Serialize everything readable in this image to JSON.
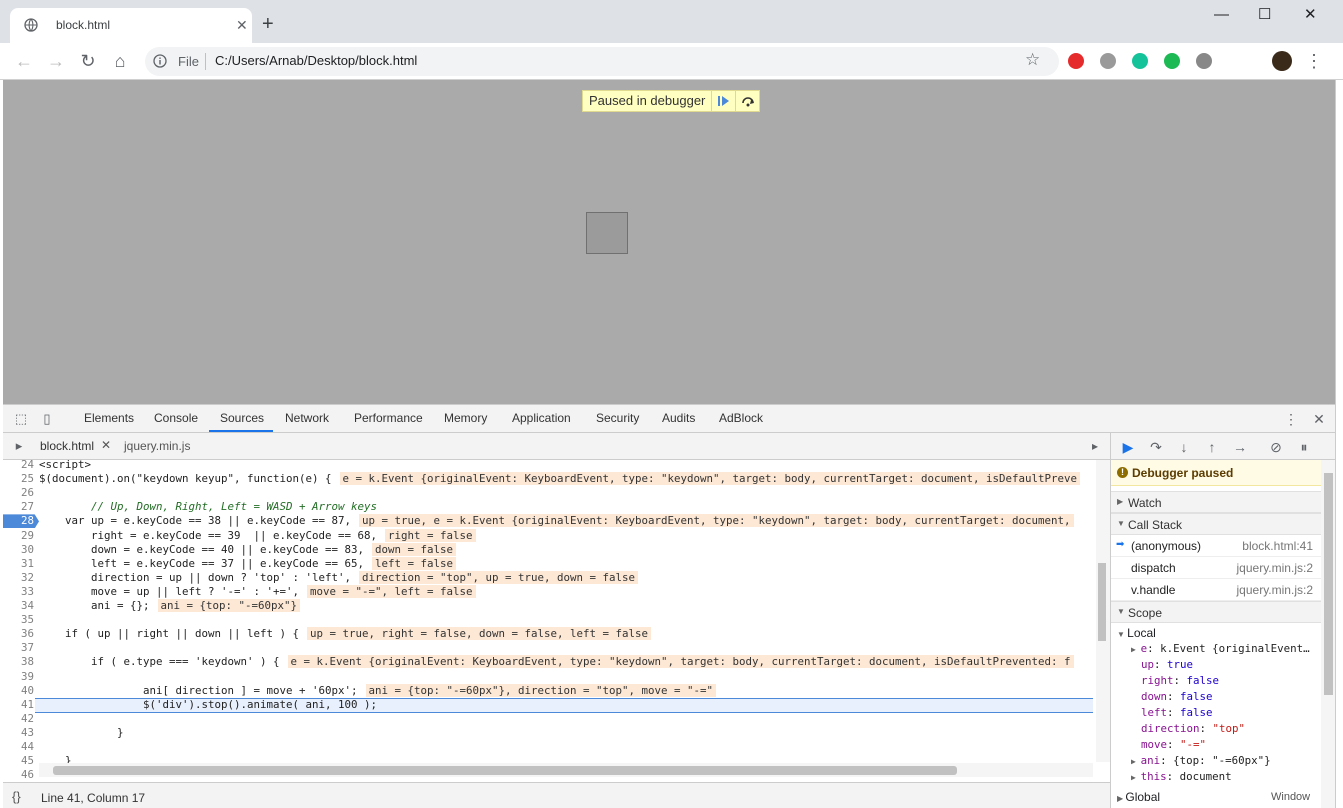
{
  "browser": {
    "tab_title": "block.html",
    "address_scheme": "File",
    "address_url": "C:/Users/Arnab/Desktop/block.html"
  },
  "page": {
    "paused_label": "Paused in debugger"
  },
  "devtools": {
    "tabs": [
      "Elements",
      "Console",
      "Sources",
      "Network",
      "Performance",
      "Memory",
      "Application",
      "Security",
      "Audits",
      "AdBlock"
    ],
    "active_tab": "Sources",
    "files": [
      "block.html",
      "jquery.min.js"
    ],
    "status_position": "Line 41, Column 17",
    "status_braces": "{}"
  },
  "editor": {
    "lines": [
      {
        "n": "24",
        "code": "<script>",
        "inline": ""
      },
      {
        "n": "25",
        "code": "$(document).on(\"keydown keyup\", function(e) {",
        "inline": "e = k.Event {originalEvent: KeyboardEvent, type: \"keydown\", target: body, currentTarget: document, isDefaultPreve"
      },
      {
        "n": "26",
        "code": "",
        "inline": ""
      },
      {
        "n": "27",
        "code": "        // Up, Down, Right, Left = WASD + Arrow keys",
        "inline": ""
      },
      {
        "n": "28",
        "code": "    var up = e.keyCode == 38 || e.keyCode == 87,",
        "inline": "up = true, e = k.Event {originalEvent: KeyboardEvent, type: \"keydown\", target: body, currentTarget: document,"
      },
      {
        "n": "29",
        "code": "        right = e.keyCode == 39  || e.keyCode == 68,",
        "inline": "right = false"
      },
      {
        "n": "30",
        "code": "        down = e.keyCode == 40 || e.keyCode == 83,",
        "inline": "down = false"
      },
      {
        "n": "31",
        "code": "        left = e.keyCode == 37 || e.keyCode == 65,",
        "inline": "left = false"
      },
      {
        "n": "32",
        "code": "        direction = up || down ? 'top' : 'left',",
        "inline": "direction = \"top\", up = true, down = false"
      },
      {
        "n": "33",
        "code": "        move = up || left ? '-=' : '+=',",
        "inline": "move = \"-=\", left = false"
      },
      {
        "n": "34",
        "code": "        ani = {};",
        "inline": "ani = {top: \"-=60px\"}"
      },
      {
        "n": "35",
        "code": "",
        "inline": ""
      },
      {
        "n": "36",
        "code": "    if ( up || right || down || left ) {",
        "inline": "up = true, right = false, down = false, left = false"
      },
      {
        "n": "37",
        "code": "",
        "inline": ""
      },
      {
        "n": "38",
        "code": "        if ( e.type === 'keydown' ) {",
        "inline": "e = k.Event {originalEvent: KeyboardEvent, type: \"keydown\", target: body, currentTarget: document, isDefaultPrevented: f"
      },
      {
        "n": "39",
        "code": "",
        "inline": ""
      },
      {
        "n": "40",
        "code": "                ani[ direction ] = move + '60px';",
        "inline": "ani = {top: \"-=60px\"}, direction = \"top\", move = \"-=\""
      },
      {
        "n": "41",
        "code": "                $('div').stop().animate( ani, 100 );",
        "inline": ""
      },
      {
        "n": "42",
        "code": "",
        "inline": ""
      },
      {
        "n": "43",
        "code": "            }",
        "inline": ""
      },
      {
        "n": "44",
        "code": "",
        "inline": ""
      },
      {
        "n": "45",
        "code": "    }",
        "inline": ""
      },
      {
        "n": "46",
        "code": "",
        "inline": ""
      }
    ]
  },
  "sidebar": {
    "paused_title": "Debugger paused",
    "watch_label": "Watch",
    "callstack_label": "Call Stack",
    "callstack": [
      {
        "name": "(anonymous)",
        "loc": "block.html:41"
      },
      {
        "name": "dispatch",
        "loc": "jquery.min.js:2"
      },
      {
        "name": "v.handle",
        "loc": "jquery.min.js:2"
      }
    ],
    "scope_label": "Scope",
    "local_label": "Local",
    "local_vars": [
      {
        "k": "e",
        "v": "k.Event {originalEvent…",
        "expand": true
      },
      {
        "k": "up",
        "v": "true",
        "expand": false
      },
      {
        "k": "right",
        "v": "false",
        "expand": false
      },
      {
        "k": "down",
        "v": "false",
        "expand": false
      },
      {
        "k": "left",
        "v": "false",
        "expand": false
      },
      {
        "k": "direction",
        "v": "\"top\"",
        "expand": false
      },
      {
        "k": "move",
        "v": "\"-=\"",
        "expand": false
      },
      {
        "k": "ani",
        "v": "{top: \"-=60px\"}",
        "expand": true
      },
      {
        "k": "this",
        "v": "document",
        "expand": true
      }
    ],
    "global_label": "Global",
    "global_value": "Window"
  },
  "colors": {
    "page_background": "#aaaaaa",
    "accent": "#1a73e8",
    "paused_banner": "#ffffc2",
    "inline_value_bg": "#fde8d5"
  }
}
